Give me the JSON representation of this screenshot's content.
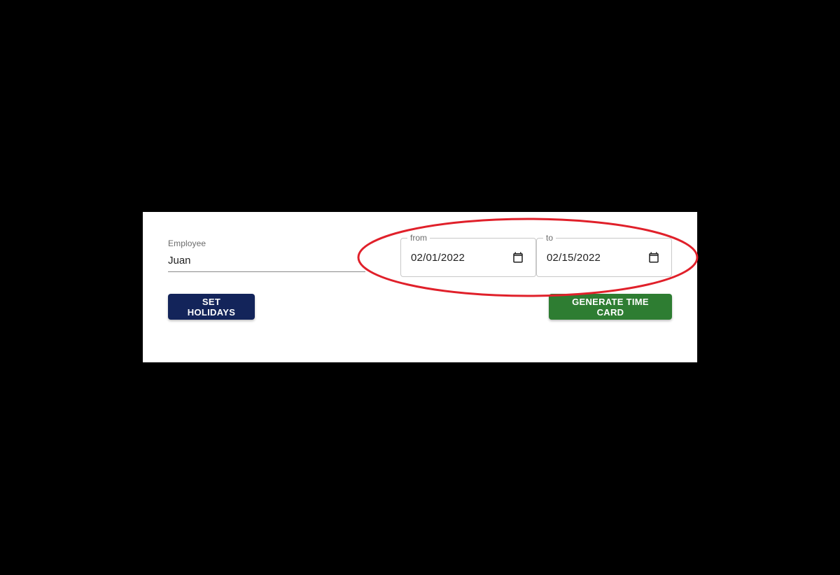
{
  "form": {
    "employee": {
      "label": "Employee",
      "value": "Juan"
    },
    "date_from": {
      "label": "from",
      "value": "02/01/2022",
      "icon": "calendar-icon"
    },
    "date_to": {
      "label": "to",
      "value": "02/15/2022",
      "icon": "calendar-icon"
    },
    "buttons": {
      "set_holidays": "SET HOLIDAYS",
      "generate_time_card": "GENERATE TIME CARD"
    }
  },
  "colors": {
    "background": "#000000",
    "card": "#ffffff",
    "set_holidays_button": "#13245a",
    "generate_button": "#2e7d32",
    "annotation_ellipse": "#e0202a"
  }
}
